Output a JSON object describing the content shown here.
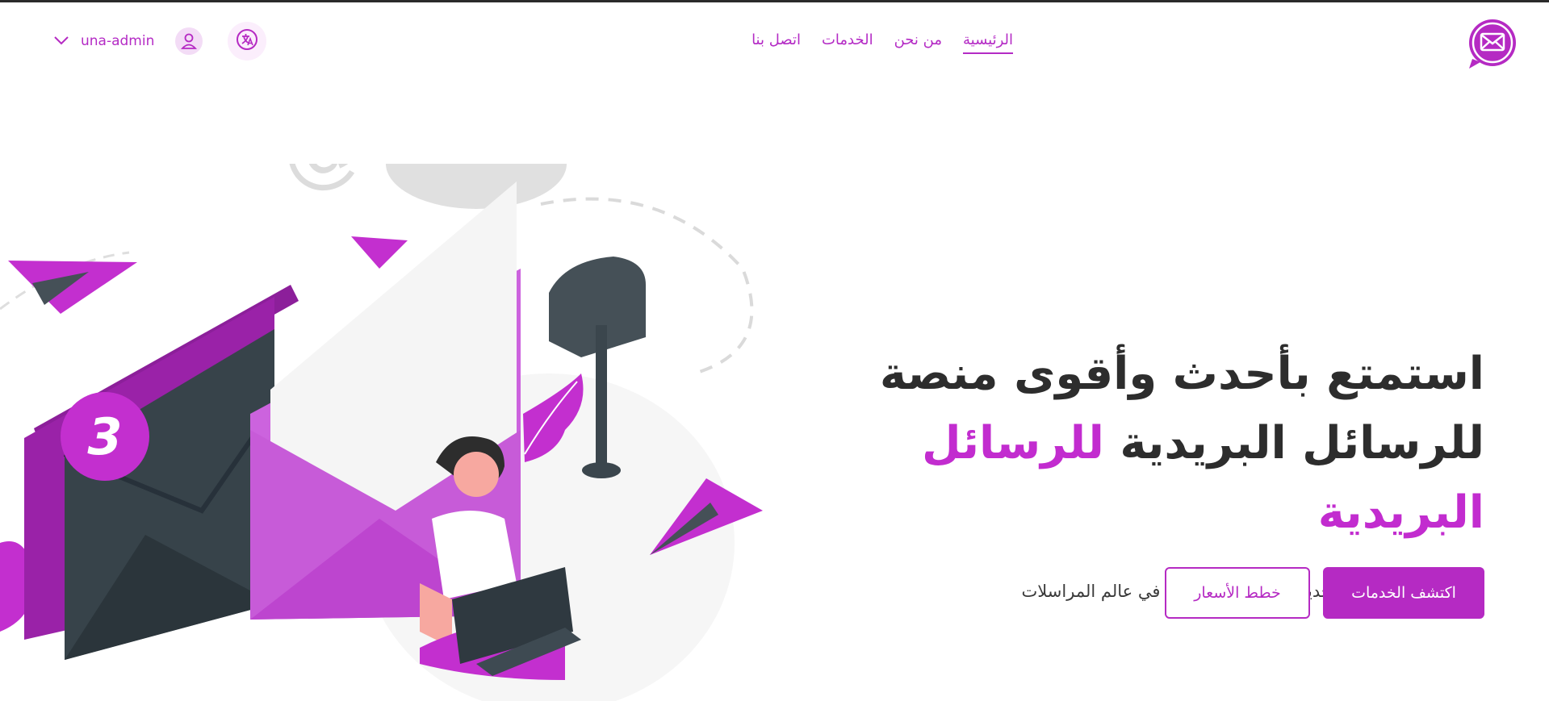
{
  "brand": {
    "logo_icon": "mail-chat-icon",
    "accent": "#b52ac3"
  },
  "nav": {
    "items": [
      {
        "label": "الرئيسية",
        "active": true
      },
      {
        "label": "من نحن",
        "active": false
      },
      {
        "label": "الخدمات",
        "active": false
      },
      {
        "label": "اتصل بنا",
        "active": false
      }
    ]
  },
  "header_actions": {
    "translate_icon": "translate-icon",
    "user_name": "una-admin",
    "user_icon": "user-icon",
    "dropdown_icon": "chevron-down-icon"
  },
  "hero": {
    "title_line1": "استمتع بأحدث وأقوى منصة",
    "title_line2_plain": "للرسائل البريدية",
    "title_line2_accent": "للرسائل البريدية",
    "subtitle": "نظام مراسلة بمفهوم جديد يوفر كل ما تحتاجه في عالم المراسلات",
    "primary_button": "اكتشف الخدمات",
    "secondary_button": "خطط الأسعار",
    "badge_count": "3",
    "at_symbol": "@"
  }
}
